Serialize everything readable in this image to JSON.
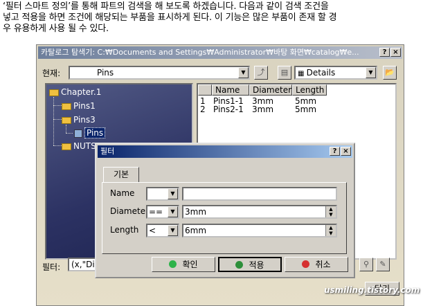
{
  "intro": {
    "line1": "‘필터 스마트 정의’를 통해 파트의 검색을 해 보도록 하겠습니다. 다음과 같이 검색 조건을",
    "line2": "넣고 적용을 하면 조건에 해당되는 부품을 표시하게 된다. 이 기능은 많은 부품이 존재 할 경",
    "line3": "우 유용하게 사용 될 수 있다."
  },
  "catalog": {
    "title": "카탈로그 탐색기: C:₩Documents and Settings₩Administrator₩바탕 화면₩catalog₩e...",
    "current_label": "현재:",
    "current_value": "Pins",
    "view_mode": "Details",
    "tree": {
      "root": "Chapter.1",
      "pins1": "Pins1",
      "pins3": "Pins3",
      "selected": "Pins",
      "nuts": "NUTS"
    },
    "columns": [
      "Name",
      "Diameter",
      "Length"
    ],
    "rows": [
      {
        "index": "1",
        "name": "Pins1-1",
        "diameter": "3mm",
        "length": "5mm"
      },
      {
        "index": "2",
        "name": "Pins2-1",
        "diameter": "3mm",
        "length": "5mm"
      }
    ],
    "filter_label": "필터:",
    "filter_value": "(x,\"Dia",
    "close_button": "닫기"
  },
  "dialog": {
    "title": "필터",
    "tab": "기본",
    "name_label": "Name",
    "name_op": "",
    "name_value": "",
    "diameter_label": "Diameter",
    "diameter_op": "==",
    "diameter_value": "3mm",
    "length_label": "Length",
    "length_op": "<",
    "length_value": "6mm",
    "ok_button": "확인",
    "apply_button": "적용",
    "cancel_button": "취소"
  },
  "watermark": "usmiling.tistory.com",
  "colors": {
    "ok_dot": "#2db34a",
    "apply_dot": "#2d8f3a",
    "cancel_dot": "#d63030"
  }
}
